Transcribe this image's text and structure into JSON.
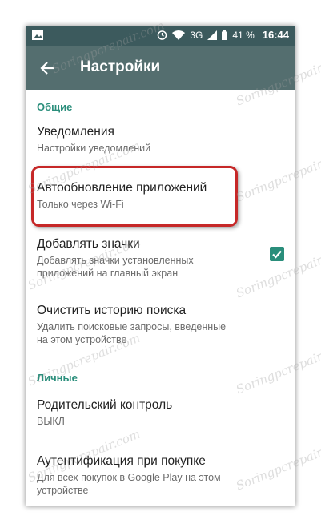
{
  "status_bar": {
    "network": "3G",
    "battery": "41 %",
    "time": "16:44"
  },
  "app_bar": {
    "title": "Настройки"
  },
  "sections": [
    {
      "header": "Общие",
      "items": [
        {
          "title": "Уведомления",
          "summary": "Настройки уведомлений"
        },
        {
          "title": "Автообновление приложений",
          "summary": "Только через Wi-Fi"
        },
        {
          "title": "Добавлять значки",
          "summary": "Добавлять значки установленных приложений на главный экран",
          "checked": true
        },
        {
          "title": "Очистить историю поиска",
          "summary": "Удалить поисковые запросы, введенные на этом устройстве"
        }
      ]
    },
    {
      "header": "Личные",
      "items": [
        {
          "title": "Родительский контроль",
          "summary": "ВЫКЛ"
        },
        {
          "title": "Аутентификация при покупке",
          "summary": "Для всех покупок в Google Play на этом устройстве"
        }
      ]
    }
  ],
  "watermark": "Soringpcrepair.com",
  "colors": {
    "status_bar": "#3c5a5d",
    "app_bar": "#546e6f",
    "accent": "#2a8e7b",
    "highlight": "#c62828"
  }
}
